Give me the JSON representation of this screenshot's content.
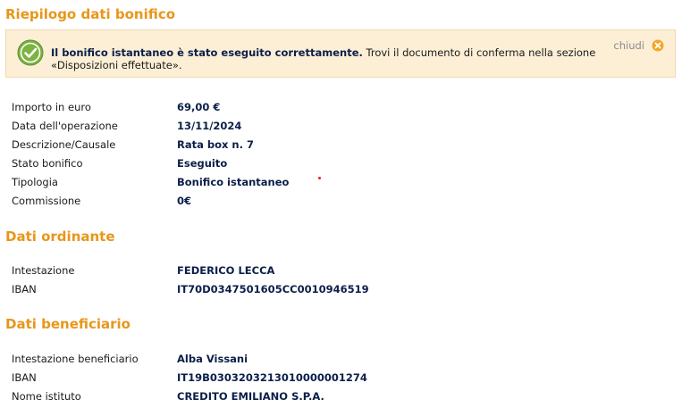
{
  "summary": {
    "title": "Riepilogo dati bonifico",
    "notice": {
      "bold": "Il bonifico istantaneo è stato eseguito correttamente.",
      "text": " Trovi il documento di conferma nella sezione «Disposizioni effettuate».",
      "close_label": "chiudi"
    },
    "rows": [
      {
        "label": "Importo in euro",
        "value": "69,00 €"
      },
      {
        "label": "Data dell'operazione",
        "value": "13/11/2024"
      },
      {
        "label": "Descrizione/Causale",
        "value": "Rata box n. 7"
      },
      {
        "label": "Stato bonifico",
        "value": "Eseguito"
      },
      {
        "label": "Tipologia",
        "value": "Bonifico istantaneo"
      },
      {
        "label": "Commissione",
        "value": "0€"
      }
    ]
  },
  "ordering": {
    "title": "Dati ordinante",
    "rows": [
      {
        "label": "Intestazione",
        "value": "FEDERICO LECCA"
      },
      {
        "label": "IBAN",
        "value": "IT70D0347501605CC0010946519"
      }
    ]
  },
  "beneficiary": {
    "title": "Dati beneficiario",
    "rows": [
      {
        "label": "Intestazione beneficiario",
        "value": "Alba Vissani"
      },
      {
        "label": "IBAN",
        "value": "IT19B0303203213010000001274"
      },
      {
        "label": "Nome istituto",
        "value": "CREDITO EMILIANO S.P.A."
      }
    ]
  },
  "colors": {
    "accent": "#e8961a",
    "notice_bg": "#fcefd6",
    "value_text": "#0b1f4a",
    "success": "#7cb342"
  },
  "icons": {
    "notice": "check-circle-icon",
    "close": "close-circle-icon"
  }
}
